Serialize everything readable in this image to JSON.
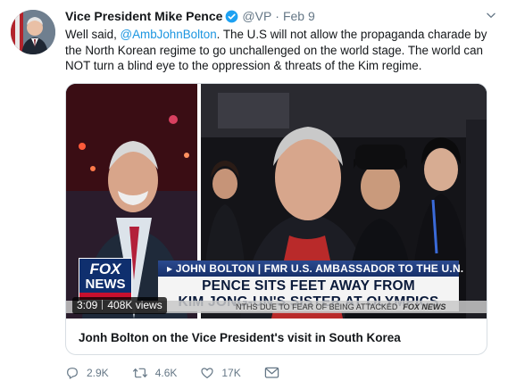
{
  "tweet": {
    "author_name": "Vice President Mike Pence",
    "handle": "@VP",
    "separator": "·",
    "timestamp": "Feb 9",
    "text_intro": "Well said, ",
    "mention": "@AmbJohnBolton",
    "text_body": ". The U.S will not allow the propaganda charade by the North Korean regime to go unchallenged on the world stage. The world can NOT turn a blind eye to the oppression & threats of the Kim regime."
  },
  "media": {
    "ticker_top": "▸ JOHN BOLTON | FMR U.S. AMBASSADOR TO THE U.N.",
    "ticker_headline_line1": "PENCE SITS FEET AWAY FROM",
    "ticker_headline_line2": "KIM JONG-UN'S SISTER AT OLYMPICS",
    "ticker_bottom": "NTHS DUE TO FEAR OF BEING ATTACKED",
    "ticker_bottom_logo": "FOX NEWS",
    "logo_line1": "FOX",
    "logo_line2": "NEWS",
    "duration": "3:09",
    "views": "408K views"
  },
  "card": {
    "title": "Jonh Bolton on the Vice President's visit in South Korea"
  },
  "actions": {
    "reply_count": "2.9K",
    "retweet_count": "4.6K",
    "like_count": "17K"
  },
  "colors": {
    "link": "#1b95e0",
    "muted": "#657786",
    "verified": "#1da1f2"
  },
  "icons": [
    "verified-badge-icon",
    "caret-down-icon",
    "reply-icon",
    "retweet-icon",
    "like-icon",
    "message-icon"
  ]
}
